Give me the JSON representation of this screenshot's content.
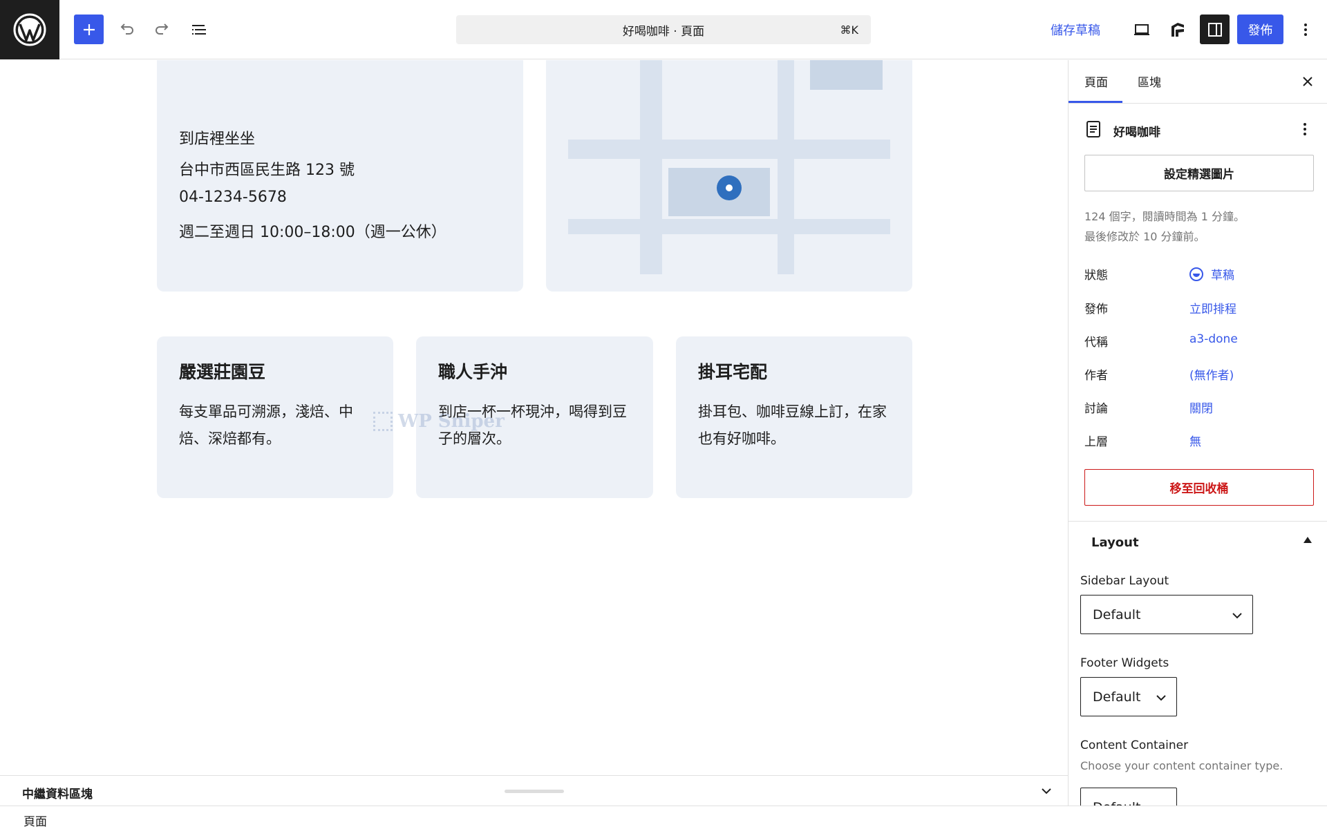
{
  "toolbar": {
    "command_title": "好喝咖啡 · 頁面",
    "command_shortcut": "⌘K",
    "save_draft": "儲存草稿",
    "publish": "發佈",
    "accent": "#3858e9"
  },
  "canvas": {
    "contact": {
      "lines": [
        "到店裡坐坐",
        "台中市西區民生路 123 號",
        "04-1234-5678",
        "週二至週日 10:00–18:00（週一公休）"
      ]
    },
    "features": [
      {
        "title": "嚴選莊園豆",
        "body": "每支單品可溯源，淺焙、中焙、深焙都有。"
      },
      {
        "title": "職人手沖",
        "body": "到店一杯一杯現沖，喝得到豆子的層次。"
      },
      {
        "title": "掛耳宅配",
        "body": "掛耳包、咖啡豆線上訂，在家也有好咖啡。"
      }
    ],
    "watermark": "WP Sniper"
  },
  "bottom_panel": {
    "title": "中繼資料區塊"
  },
  "breadcrumb": {
    "label": "頁面"
  },
  "sidebar": {
    "tabs": [
      "頁面",
      "區塊"
    ],
    "doc_title": "好喝咖啡",
    "featured_image_button": "設定精選圖片",
    "meta": [
      "124 個字，閱讀時間為 1 分鐘。",
      "最後修改於 10 分鐘前。"
    ],
    "properties": [
      {
        "label": "狀態",
        "value": "草稿"
      },
      {
        "label": "發佈",
        "value": "立即排程"
      },
      {
        "label": "代稱",
        "value": "a3-done"
      },
      {
        "label": "作者",
        "value": "(無作者)"
      },
      {
        "label": "討論",
        "value": "關閉"
      },
      {
        "label": "上層",
        "value": "無"
      }
    ],
    "trash_button": "移至回收桶",
    "layout": {
      "title": "Layout",
      "sidebar_layout_label": "Sidebar Layout",
      "sidebar_layout_value": "Default",
      "footer_widgets_label": "Footer Widgets",
      "footer_widgets_value": "Default",
      "content_container_label": "Content Container",
      "content_container_help": "Choose your content container type.",
      "content_container_value": "Default"
    }
  }
}
